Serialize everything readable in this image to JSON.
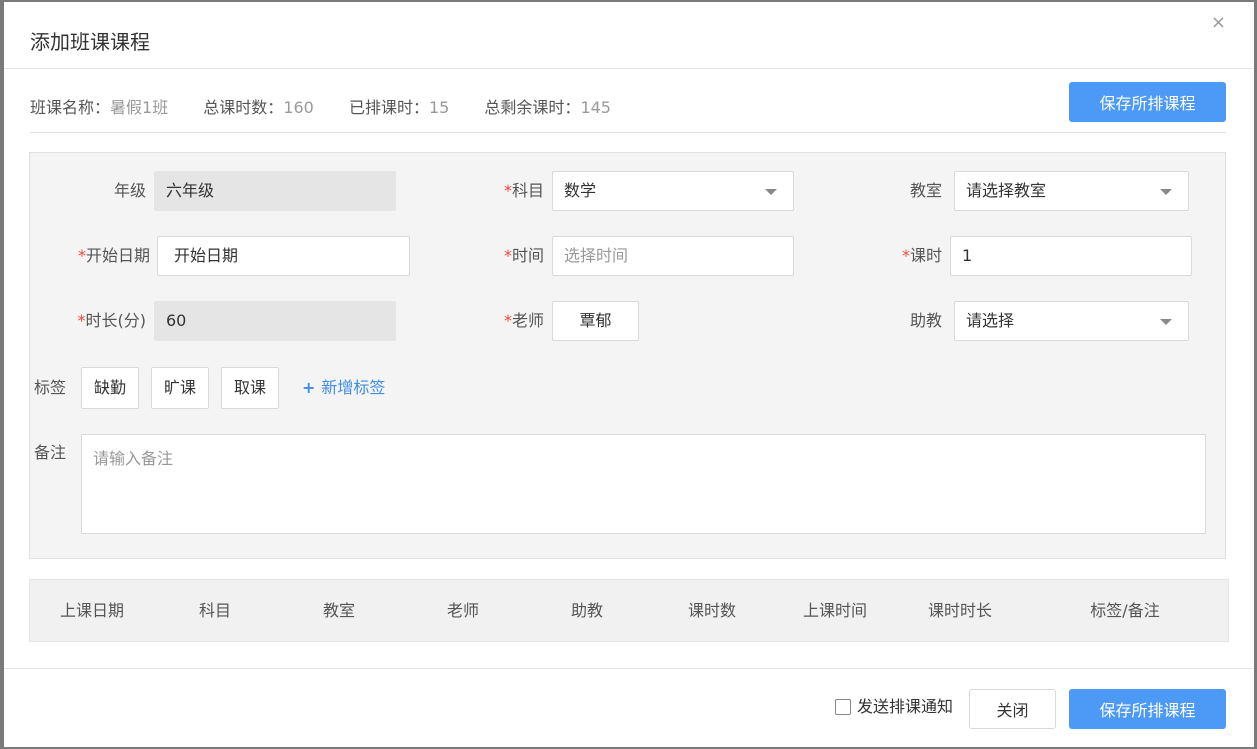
{
  "dialog": {
    "title": "添加班课课程",
    "close_glyph": "×"
  },
  "summary": {
    "class_name_label": "班课名称：",
    "class_name": "暑假1班",
    "total_hours_label": "总课时数：",
    "total_hours": "160",
    "scheduled_label": "已排课时：",
    "scheduled": "15",
    "remaining_label": "总剩余课时：",
    "remaining": "145"
  },
  "buttons": {
    "save_all": "保存所排课程",
    "close": "关闭"
  },
  "form": {
    "grade_label": "年级",
    "grade_value": "六年级",
    "subject_label": "科目",
    "subject_value": "数学",
    "classroom_label": "教室",
    "classroom_value": "请选择教室",
    "start_date_label": "开始日期",
    "start_date_value": "开始日期",
    "time_label": "时间",
    "time_placeholder": "选择时间",
    "hours_label": "课时",
    "hours_value": "1",
    "duration_label": "时长(分)",
    "duration_value": "60",
    "teacher_label": "老师",
    "teacher_value": "覃郁",
    "assistant_label": "助教",
    "assistant_value": "请选择",
    "tags_label": "标签",
    "tags": [
      "缺勤",
      "旷课",
      "取课"
    ],
    "add_tag": "新增标签",
    "add_tag_plus": "+",
    "notes_label": "备注",
    "notes_placeholder": "请输入备注",
    "required_mark": "*"
  },
  "table": {
    "columns": [
      "上课日期",
      "科目",
      "教室",
      "老师",
      "助教",
      "课时数",
      "上课时间",
      "课时时长",
      "标签/备注"
    ]
  },
  "footer": {
    "notify_label": "发送排课通知"
  }
}
